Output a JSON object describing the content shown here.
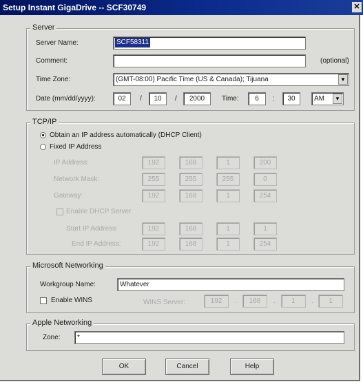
{
  "window": {
    "title": "Setup Instant GigaDrive -- SCF30749",
    "close_glyph": "✕"
  },
  "server": {
    "group_label": "Server",
    "server_name_label": "Server Name:",
    "server_name_value": "SCF58311",
    "comment_label": "Comment:",
    "comment_value": "",
    "optional_label": "(optional)",
    "time_zone_label": "Time Zone:",
    "time_zone_value": "(GMT-08:00) Pacific Time (US & Canada); Tijuana",
    "date_label": "Date (mm/dd/yyyy):",
    "date_month": "02",
    "date_day": "10",
    "date_year": "2000",
    "date_sep": "/",
    "time_label": "Time:",
    "time_hour": "6",
    "time_sep": ":",
    "time_minute": "30",
    "ampm_value": "AM"
  },
  "tcpip": {
    "group_label": "TCP/IP",
    "dhcp_client_label": "Obtain an IP address automatically (DHCP Client)",
    "fixed_ip_label": "Fixed IP Address",
    "ip_address_label": "IP Address:",
    "ip_address": [
      "192",
      "168",
      "1",
      "200"
    ],
    "netmask_label": "Network Mask:",
    "netmask": [
      "255",
      "255",
      "255",
      "0"
    ],
    "gateway_label": "Gateway:",
    "gateway": [
      "192",
      "168",
      "1",
      "254"
    ],
    "enable_dhcp_server_label": "Enable DHCP Server",
    "start_ip_label": "Start IP Address:",
    "start_ip": [
      "192",
      "168",
      "1",
      "1"
    ],
    "end_ip_label": "End IP Address:",
    "end_ip": [
      "192",
      "168",
      "1",
      "254"
    ],
    "octet_sep": "."
  },
  "microsoft": {
    "group_label": "Microsoft Networking",
    "workgroup_label": "Workgroup Name:",
    "workgroup_value": "Whatever",
    "enable_wins_label": "Enable WINS",
    "wins_server_label": "WINS Server:",
    "wins_server": [
      "192",
      "168",
      "1",
      "1"
    ]
  },
  "apple": {
    "group_label": "Apple Networking",
    "zone_label": "Zone:",
    "zone_value": "*"
  },
  "buttons": {
    "ok": "OK",
    "cancel": "Cancel",
    "help": "Help"
  },
  "colors": {
    "title_bar": "#0b2a8a",
    "dialog_bg": "#dcdcd8",
    "selection": "#1c2f8a"
  }
}
